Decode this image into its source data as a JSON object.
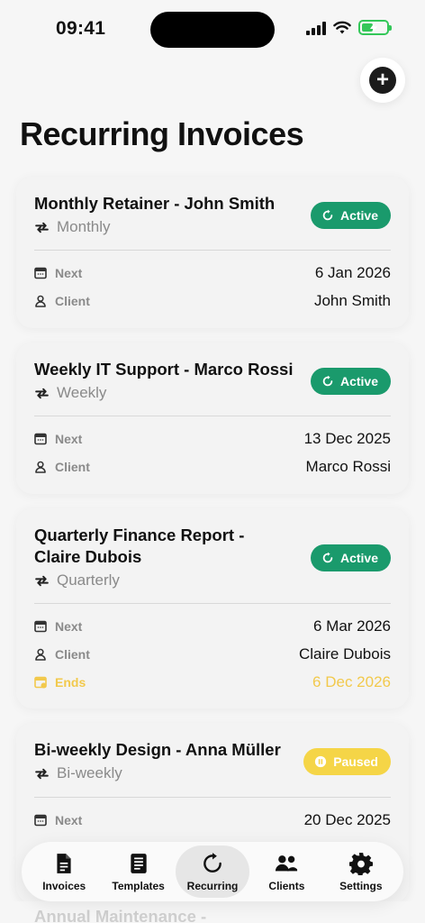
{
  "status": {
    "time": "09:41"
  },
  "page": {
    "title": "Recurring Invoices",
    "add_icon": "plus-icon"
  },
  "labels": {
    "next": "Next",
    "client": "Client",
    "ends": "Ends"
  },
  "colors": {
    "active": "#1a9a6c",
    "paused": "#f5d547",
    "ends": "#f2c94c"
  },
  "invoices": [
    {
      "title_line1": "Monthly Retainer - John Smith",
      "title_line2": "",
      "frequency": "Monthly",
      "status": "Active",
      "next": "6 Jan 2026",
      "client": "John Smith"
    },
    {
      "title_line1": "Weekly IT Support - Marco Rossi",
      "title_line2": "",
      "frequency": "Weekly",
      "status": "Active",
      "next": "13 Dec 2025",
      "client": "Marco Rossi"
    },
    {
      "title_line1": "Quarterly Finance Report -",
      "title_line2": "Claire Dubois",
      "frequency": "Quarterly",
      "status": "Active",
      "next": "6 Mar 2026",
      "client": "Claire Dubois",
      "ends": "6 Dec 2026"
    },
    {
      "title_line1": "Bi-weekly Design - Anna Müller",
      "title_line2": "",
      "frequency": "Bi-weekly",
      "status": "Paused",
      "next": "20 Dec 2025"
    },
    {
      "title_line1": "Annual Maintenance -"
    }
  ],
  "nav": [
    {
      "label": "Invoices",
      "icon": "document-icon"
    },
    {
      "label": "Templates",
      "icon": "template-icon"
    },
    {
      "label": "Recurring",
      "icon": "refresh-icon",
      "selected": true
    },
    {
      "label": "Clients",
      "icon": "people-icon"
    },
    {
      "label": "Settings",
      "icon": "gear-icon"
    }
  ]
}
